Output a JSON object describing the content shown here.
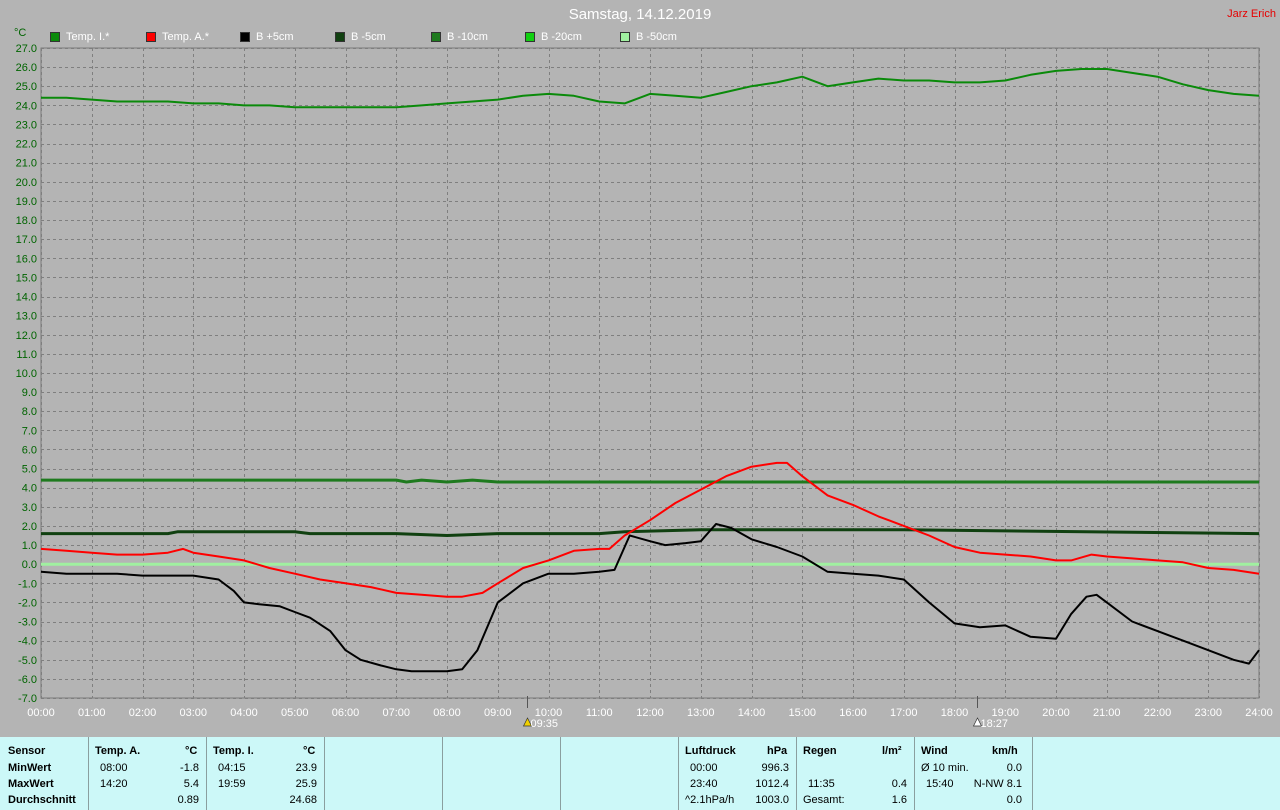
{
  "title": "Samstag, 14.12.2019",
  "author": "Jarz Erich",
  "legend": [
    {
      "label": "Temp. I.*",
      "color": "#0a8a0a"
    },
    {
      "label": "Temp. A.*",
      "color": "#ff0000"
    },
    {
      "label": "B +5cm",
      "color": "#000000"
    },
    {
      "label": "B -5cm",
      "color": "#104010"
    },
    {
      "label": "B -10cm",
      "color": "#1e7a1e"
    },
    {
      "label": "B -20cm",
      "color": "#10d010"
    },
    {
      "label": "B -50cm",
      "color": "#a0f0a0"
    }
  ],
  "markers": [
    {
      "time": "09:35",
      "icon": "sunrise-icon"
    },
    {
      "time": "18:27",
      "icon": "sunset-icon"
    }
  ],
  "chart_data": {
    "type": "line",
    "ylabel": "°C",
    "ylim": [
      -7,
      27
    ],
    "xlim": [
      0,
      24
    ],
    "grid": true,
    "y_ticks": [
      "27.0",
      "26.0",
      "25.0",
      "24.0",
      "23.0",
      "22.0",
      "21.0",
      "20.0",
      "19.0",
      "18.0",
      "17.0",
      "16.0",
      "15.0",
      "14.0",
      "13.0",
      "12.0",
      "11.0",
      "10.0",
      "9.0",
      "8.0",
      "7.0",
      "6.0",
      "5.0",
      "4.0",
      "3.0",
      "2.0",
      "1.0",
      "0.0",
      "-1.0",
      "-2.0",
      "-3.0",
      "-4.0",
      "-5.0",
      "-6.0",
      "-7.0"
    ],
    "x_ticks": [
      "00:00",
      "01:00",
      "02:00",
      "03:00",
      "04:00",
      "05:00",
      "06:00",
      "07:00",
      "08:00",
      "09:00",
      "10:00",
      "11:00",
      "12:00",
      "13:00",
      "14:00",
      "15:00",
      "16:00",
      "17:00",
      "18:00",
      "19:00",
      "20:00",
      "21:00",
      "22:00",
      "23:00",
      "24:00"
    ],
    "series": [
      {
        "name": "Temp. I.*",
        "color": "#0a8a0a",
        "width": 2,
        "x": [
          0,
          0.5,
          1,
          1.5,
          2,
          2.5,
          3,
          3.5,
          4,
          4.5,
          5,
          5.5,
          6,
          6.5,
          7,
          7.5,
          8,
          8.5,
          9,
          9.5,
          10,
          10.5,
          11,
          11.5,
          12,
          12.5,
          13,
          13.5,
          14,
          14.5,
          15,
          15.5,
          16,
          16.5,
          17,
          17.5,
          18,
          18.5,
          19,
          19.5,
          20,
          20.5,
          21,
          21.5,
          22,
          22.5,
          23,
          23.5,
          24
        ],
        "y": [
          24.4,
          24.4,
          24.3,
          24.2,
          24.2,
          24.2,
          24.1,
          24.1,
          24.0,
          24.0,
          23.9,
          23.9,
          23.9,
          23.9,
          23.9,
          24.0,
          24.1,
          24.2,
          24.3,
          24.5,
          24.6,
          24.5,
          24.2,
          24.1,
          24.6,
          24.5,
          24.4,
          24.7,
          25.0,
          25.2,
          25.5,
          25.0,
          25.2,
          25.4,
          25.3,
          25.3,
          25.2,
          25.2,
          25.3,
          25.6,
          25.8,
          25.9,
          25.9,
          25.7,
          25.5,
          25.1,
          24.8,
          24.6,
          24.5
        ]
      },
      {
        "name": "Temp. A.*",
        "color": "#ff0000",
        "width": 2,
        "x": [
          0,
          0.5,
          1,
          1.5,
          2,
          2.5,
          2.8,
          3,
          3.5,
          4,
          4.5,
          5,
          5.5,
          6,
          6.5,
          7,
          7.5,
          8,
          8.3,
          8.7,
          9,
          9.5,
          10,
          10.5,
          11,
          11.2,
          11.5,
          12,
          12.5,
          13,
          13.5,
          14,
          14.5,
          14.7,
          15,
          15.5,
          16,
          16.5,
          17,
          17.5,
          18,
          18.5,
          19,
          19.5,
          20,
          20.3,
          20.7,
          21,
          21.5,
          22,
          22.5,
          23,
          23.5,
          24
        ],
        "y": [
          0.8,
          0.7,
          0.6,
          0.5,
          0.5,
          0.6,
          0.8,
          0.6,
          0.4,
          0.2,
          -0.2,
          -0.5,
          -0.8,
          -1.0,
          -1.2,
          -1.5,
          -1.6,
          -1.7,
          -1.7,
          -1.5,
          -1.0,
          -0.2,
          0.2,
          0.7,
          0.8,
          0.8,
          1.5,
          2.3,
          3.2,
          3.9,
          4.6,
          5.1,
          5.3,
          5.3,
          4.6,
          3.6,
          3.1,
          2.5,
          2.0,
          1.5,
          0.9,
          0.6,
          0.5,
          0.4,
          0.2,
          0.2,
          0.5,
          0.4,
          0.3,
          0.2,
          0.1,
          -0.2,
          -0.3,
          -0.5
        ]
      },
      {
        "name": "B +5cm",
        "color": "#000000",
        "width": 2,
        "x": [
          0,
          0.5,
          1,
          1.5,
          2,
          2.5,
          3,
          3.5,
          3.8,
          4,
          4.3,
          4.7,
          5,
          5.3,
          5.7,
          6,
          6.3,
          6.7,
          7,
          7.3,
          7.7,
          8,
          8.3,
          8.6,
          9,
          9.5,
          10,
          10.5,
          11,
          11.3,
          11.6,
          12,
          12.3,
          12.7,
          13,
          13.3,
          13.6,
          14,
          14.5,
          15,
          15.5,
          16,
          16.5,
          17,
          17.5,
          18,
          18.5,
          19,
          19.5,
          20,
          20.3,
          20.6,
          20.8,
          21,
          21.5,
          22,
          22.5,
          23,
          23.5,
          23.8,
          24
        ],
        "y": [
          -0.4,
          -0.5,
          -0.5,
          -0.5,
          -0.6,
          -0.6,
          -0.6,
          -0.8,
          -1.4,
          -2.0,
          -2.1,
          -2.2,
          -2.5,
          -2.8,
          -3.5,
          -4.5,
          -5.0,
          -5.3,
          -5.5,
          -5.6,
          -5.6,
          -5.6,
          -5.5,
          -4.5,
          -2.0,
          -1.0,
          -0.5,
          -0.5,
          -0.4,
          -0.3,
          1.5,
          1.2,
          1.0,
          1.1,
          1.2,
          2.1,
          1.9,
          1.3,
          0.9,
          0.4,
          -0.4,
          -0.5,
          -0.6,
          -0.8,
          -2.0,
          -3.1,
          -3.3,
          -3.2,
          -3.8,
          -3.9,
          -2.6,
          -1.7,
          -1.6,
          -2.0,
          -3.0,
          -3.5,
          -4.0,
          -4.5,
          -5.0,
          -5.2,
          -4.5
        ]
      },
      {
        "name": "B -5cm",
        "color": "#104010",
        "width": 3,
        "x": [
          0,
          2.5,
          2.7,
          3,
          5,
          5.3,
          7,
          8,
          9,
          11,
          11.5,
          13,
          17,
          24
        ],
        "y": [
          1.6,
          1.6,
          1.7,
          1.7,
          1.7,
          1.6,
          1.6,
          1.5,
          1.6,
          1.6,
          1.7,
          1.8,
          1.8,
          1.6
        ]
      },
      {
        "name": "B -10cm",
        "color": "#1e7a1e",
        "width": 3,
        "x": [
          0,
          7,
          7.2,
          7.5,
          8,
          8.5,
          9,
          24
        ],
        "y": [
          4.4,
          4.4,
          4.3,
          4.4,
          4.3,
          4.4,
          4.3,
          4.3
        ]
      },
      {
        "name": "B -50cm",
        "color": "#a0f0a0",
        "width": 3,
        "x": [
          0,
          24
        ],
        "y": [
          0.0,
          0.0
        ]
      }
    ]
  },
  "stats": {
    "temp": {
      "headers": {
        "sensor": "Sensor",
        "temp_a": "Temp. A.",
        "unit_a": "°C",
        "temp_i": "Temp. I.",
        "unit_i": "°C"
      },
      "rows": [
        {
          "label": "MinWert",
          "a_time": "08:00",
          "a_val": "-1.8",
          "i_time": "04:15",
          "i_val": "23.9"
        },
        {
          "label": "MaxWert",
          "a_time": "14:20",
          "a_val": "5.4",
          "i_time": "19:59",
          "i_val": "25.9"
        },
        {
          "label": "Durchschnitt",
          "a_time": "",
          "a_val": "0.89",
          "i_time": "",
          "i_val": "24.68"
        }
      ]
    },
    "pressure": {
      "header": "Luftdruck",
      "unit": "hPa",
      "rows": [
        {
          "time": "00:00",
          "val": "996.3"
        },
        {
          "time": "23:40",
          "val": "1012.4"
        },
        {
          "time": "^2.1hPa/h",
          "val": "1003.0"
        }
      ]
    },
    "rain": {
      "header": "Regen",
      "unit": "l/m²",
      "rows": [
        {
          "time": "",
          "val": ""
        },
        {
          "time": "11:35",
          "val": "0.4"
        },
        {
          "time": "Gesamt:",
          "val": "1.6"
        }
      ]
    },
    "wind": {
      "header": "Wind",
      "unit": "km/h",
      "rows": [
        {
          "time": "Ø 10 min.",
          "val": "0.0"
        },
        {
          "time": "15:40",
          "val": "N-NW 8.1"
        },
        {
          "time": "",
          "val": "0.0"
        }
      ]
    }
  }
}
